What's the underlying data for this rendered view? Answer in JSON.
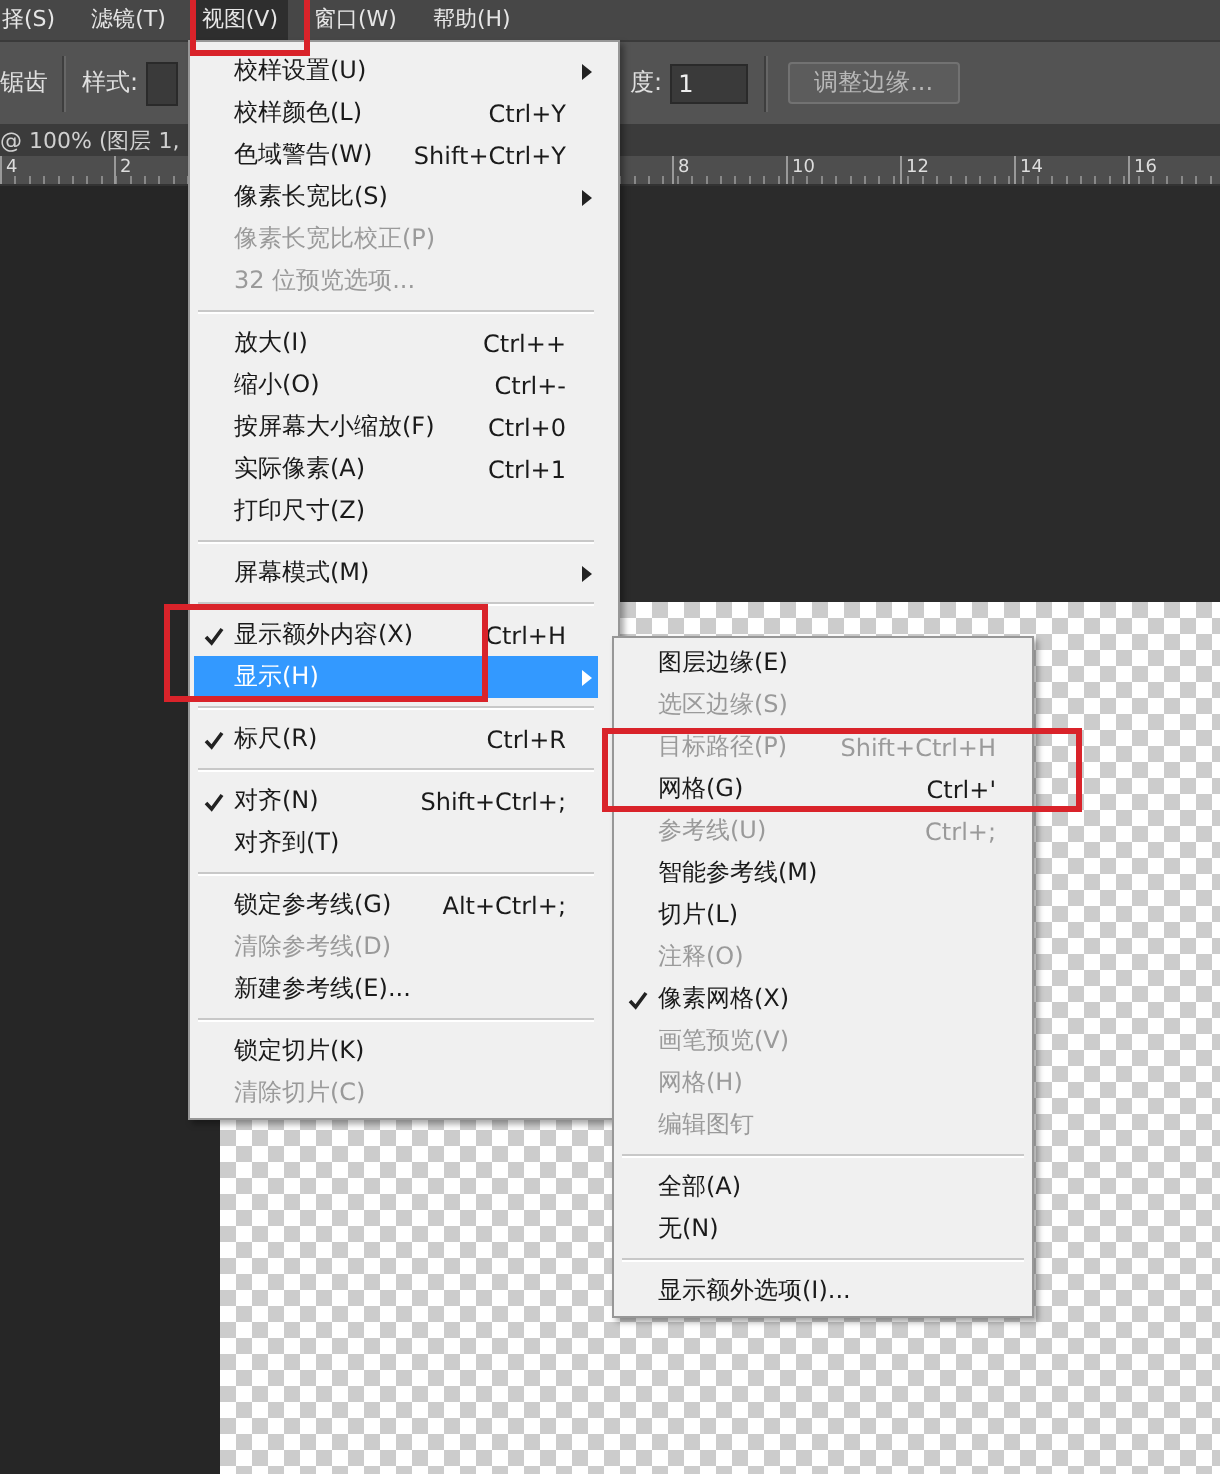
{
  "menubar": [
    {
      "label": "择(S)",
      "selected": false
    },
    {
      "label": "滤镜(T)",
      "selected": false
    },
    {
      "label": "视图(V)",
      "selected": true
    },
    {
      "label": "窗口(W)",
      "selected": false
    },
    {
      "label": "帮助(H)",
      "selected": false
    }
  ],
  "options_bar": {
    "antialias_label": "锯齿",
    "style_label": "样式:",
    "width_label": "度:",
    "width_value": "1",
    "refine_button": "调整边缘..."
  },
  "document_tab": {
    "title": "@ 100% (图层 1,"
  },
  "ruler": {
    "left_labels": [
      "4",
      "2"
    ],
    "right_labels": [
      "8",
      "10",
      "12",
      "14",
      "16"
    ]
  },
  "view_menu": [
    {
      "kind": "item",
      "label": "校样设置(U)",
      "submenu": true,
      "checked": false,
      "disabled": false,
      "selected": false
    },
    {
      "kind": "item",
      "label": "校样颜色(L)",
      "shortcut": "Ctrl+Y",
      "submenu": false,
      "checked": false,
      "disabled": false,
      "selected": false
    },
    {
      "kind": "item",
      "label": "色域警告(W)",
      "shortcut": "Shift+Ctrl+Y",
      "submenu": false,
      "checked": false,
      "disabled": false,
      "selected": false
    },
    {
      "kind": "item",
      "label": "像素长宽比(S)",
      "submenu": true,
      "checked": false,
      "disabled": false,
      "selected": false
    },
    {
      "kind": "item",
      "label": "像素长宽比校正(P)",
      "submenu": false,
      "checked": false,
      "disabled": true,
      "selected": false
    },
    {
      "kind": "item",
      "label": "32 位预览选项...",
      "submenu": false,
      "checked": false,
      "disabled": true,
      "selected": false
    },
    {
      "kind": "separator"
    },
    {
      "kind": "item",
      "label": "放大(I)",
      "shortcut": "Ctrl++",
      "submenu": false,
      "checked": false,
      "disabled": false,
      "selected": false
    },
    {
      "kind": "item",
      "label": "缩小(O)",
      "shortcut": "Ctrl+-",
      "submenu": false,
      "checked": false,
      "disabled": false,
      "selected": false
    },
    {
      "kind": "item",
      "label": "按屏幕大小缩放(F)",
      "shortcut": "Ctrl+0",
      "submenu": false,
      "checked": false,
      "disabled": false,
      "selected": false
    },
    {
      "kind": "item",
      "label": "实际像素(A)",
      "shortcut": "Ctrl+1",
      "submenu": false,
      "checked": false,
      "disabled": false,
      "selected": false
    },
    {
      "kind": "item",
      "label": "打印尺寸(Z)",
      "submenu": false,
      "checked": false,
      "disabled": false,
      "selected": false
    },
    {
      "kind": "separator"
    },
    {
      "kind": "item",
      "label": "屏幕模式(M)",
      "submenu": true,
      "checked": false,
      "disabled": false,
      "selected": false
    },
    {
      "kind": "separator"
    },
    {
      "kind": "item",
      "label": "显示额外内容(X)",
      "shortcut": "Ctrl+H",
      "submenu": false,
      "checked": true,
      "disabled": false,
      "selected": false
    },
    {
      "kind": "item",
      "label": "显示(H)",
      "submenu": true,
      "checked": false,
      "disabled": false,
      "selected": true,
      "expanded": true,
      "children": [
        {
          "kind": "item",
          "label": "图层边缘(E)",
          "checked": false,
          "disabled": false
        },
        {
          "kind": "item",
          "label": "选区边缘(S)",
          "checked": false,
          "disabled": true
        },
        {
          "kind": "item",
          "label": "目标路径(P)",
          "shortcut": "Shift+Ctrl+H",
          "checked": false,
          "disabled": true
        },
        {
          "kind": "item",
          "label": "网格(G)",
          "shortcut": "Ctrl+'",
          "checked": false,
          "disabled": false
        },
        {
          "kind": "item",
          "label": "参考线(U)",
          "shortcut": "Ctrl+;",
          "checked": false,
          "disabled": true
        },
        {
          "kind": "item",
          "label": "智能参考线(M)",
          "checked": false,
          "disabled": false
        },
        {
          "kind": "item",
          "label": "切片(L)",
          "checked": false,
          "disabled": false
        },
        {
          "kind": "item",
          "label": "注释(O)",
          "checked": false,
          "disabled": true
        },
        {
          "kind": "item",
          "label": "像素网格(X)",
          "checked": true,
          "disabled": false
        },
        {
          "kind": "item",
          "label": "画笔预览(V)",
          "checked": false,
          "disabled": true
        },
        {
          "kind": "item",
          "label": "网格(H)",
          "checked": false,
          "disabled": true
        },
        {
          "kind": "item",
          "label": "编辑图钉",
          "checked": false,
          "disabled": true
        },
        {
          "kind": "separator"
        },
        {
          "kind": "item",
          "label": "全部(A)",
          "checked": false,
          "disabled": false
        },
        {
          "kind": "item",
          "label": "无(N)",
          "checked": false,
          "disabled": false
        },
        {
          "kind": "separator"
        },
        {
          "kind": "item",
          "label": "显示额外选项(I)...",
          "checked": false,
          "disabled": false
        }
      ]
    },
    {
      "kind": "separator"
    },
    {
      "kind": "item",
      "label": "标尺(R)",
      "shortcut": "Ctrl+R",
      "submenu": false,
      "checked": true,
      "disabled": false,
      "selected": false
    },
    {
      "kind": "separator"
    },
    {
      "kind": "item",
      "label": "对齐(N)",
      "shortcut": "Shift+Ctrl+;",
      "submenu": false,
      "checked": true,
      "disabled": false,
      "selected": false
    },
    {
      "kind": "item",
      "label": "对齐到(T)",
      "submenu": false,
      "checked": false,
      "disabled": false,
      "selected": false
    },
    {
      "kind": "separator"
    },
    {
      "kind": "item",
      "label": "锁定参考线(G)",
      "shortcut": "Alt+Ctrl+;",
      "submenu": false,
      "checked": false,
      "disabled": false,
      "selected": false
    },
    {
      "kind": "item",
      "label": "清除参考线(D)",
      "submenu": false,
      "checked": false,
      "disabled": true,
      "selected": false
    },
    {
      "kind": "item",
      "label": "新建参考线(E)...",
      "submenu": false,
      "checked": false,
      "disabled": false,
      "selected": false
    },
    {
      "kind": "separator"
    },
    {
      "kind": "item",
      "label": "锁定切片(K)",
      "submenu": false,
      "checked": false,
      "disabled": false,
      "selected": false
    },
    {
      "kind": "item",
      "label": "清除切片(C)",
      "submenu": false,
      "checked": false,
      "disabled": true,
      "selected": false
    }
  ]
}
